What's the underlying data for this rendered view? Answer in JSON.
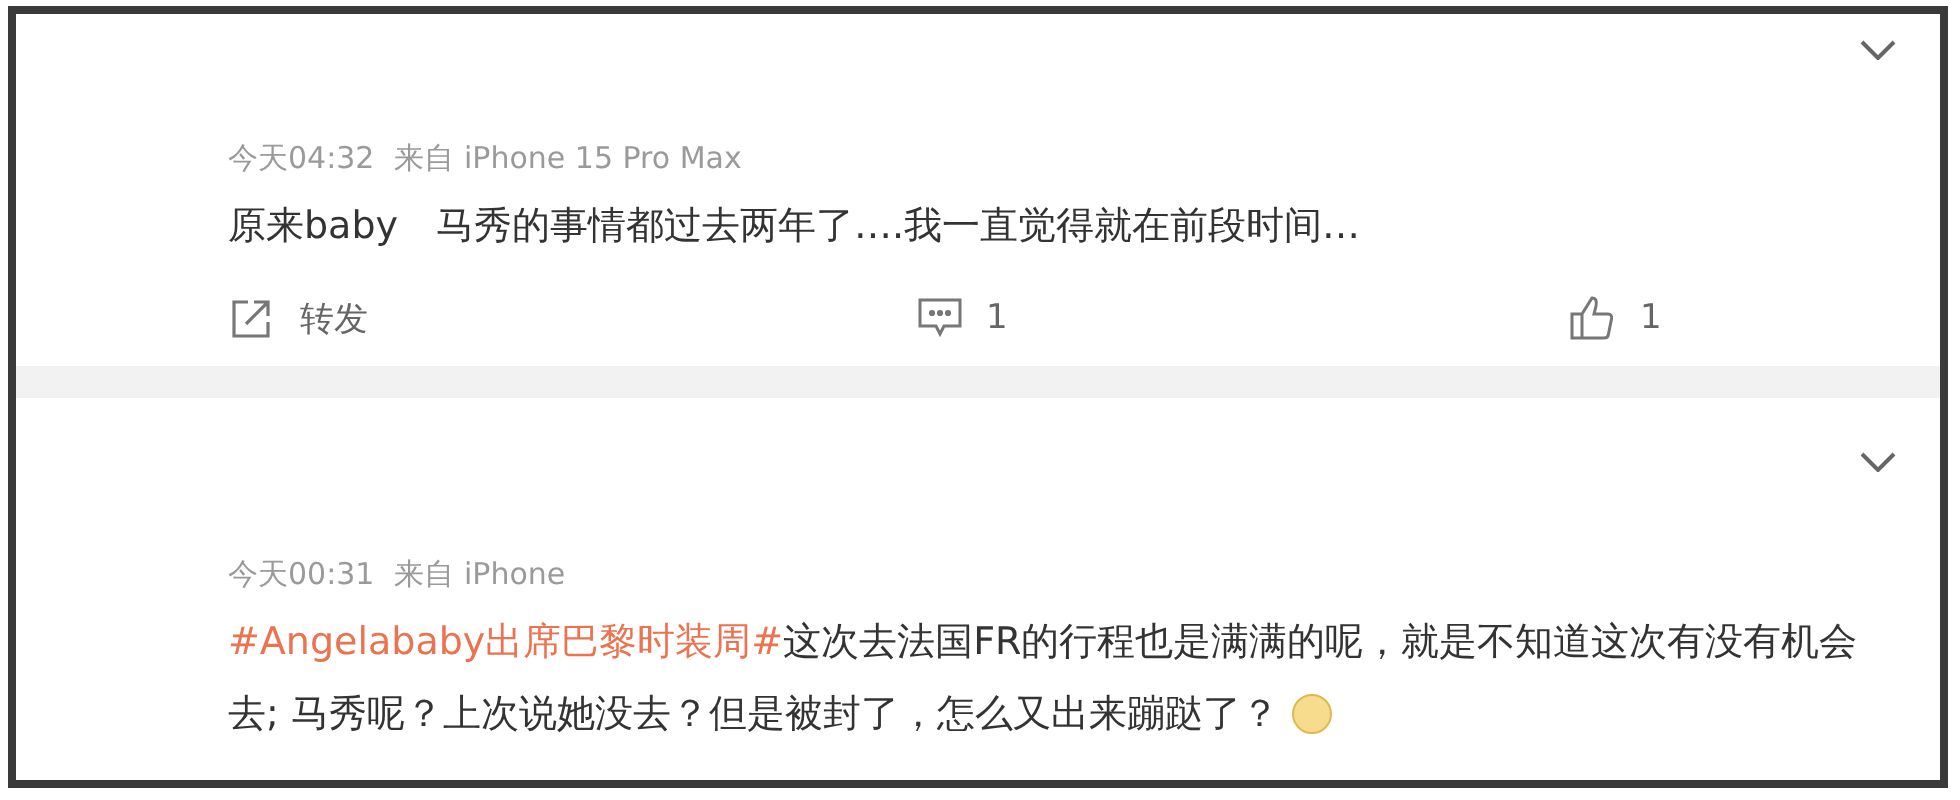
{
  "comments": [
    {
      "meta": {
        "time": "今天04:32",
        "source": "来自 iPhone 15 Pro Max"
      },
      "text": "原来baby　马秀的事情都过去两年了….我一直觉得就在前段时间…",
      "emoji": false,
      "actions": [
        {
          "kind": "repost",
          "label": "转发"
        },
        {
          "kind": "comment",
          "label": "1"
        },
        {
          "kind": "like",
          "label": "1"
        }
      ]
    },
    {
      "meta": {
        "time": "今天00:31",
        "source": "来自 iPhone"
      },
      "hashtag": "#Angelababy出席巴黎时装周#",
      "text": "这次去法国FR的行程也是满满的呢，就是不知道这次有没有机会去; 马秀呢？上次说她没去？但是被封了，怎么又出来蹦跶了？",
      "emoji": true
    }
  ]
}
